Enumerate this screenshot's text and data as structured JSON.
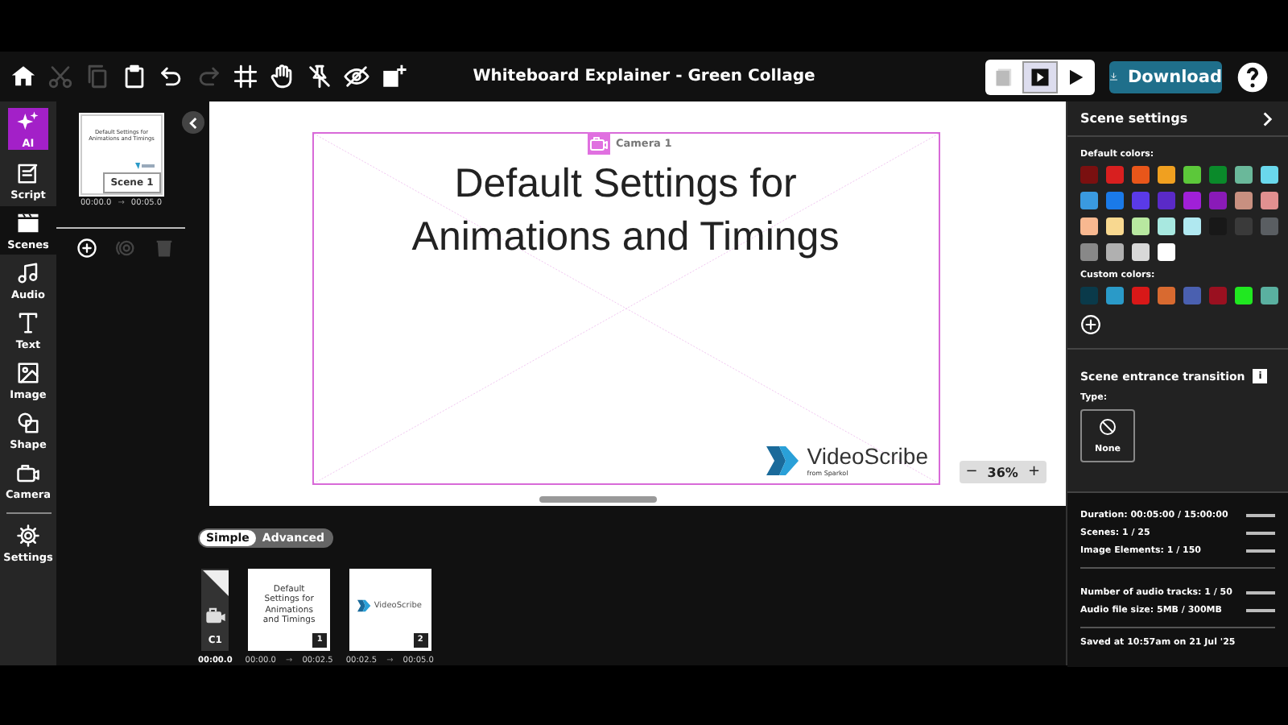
{
  "toolbar": {
    "items": [
      {
        "disabled": false
      },
      {
        "disabled": true
      },
      {
        "disabled": true
      },
      {
        "disabled": false
      },
      {
        "disabled": false
      },
      {
        "disabled": true
      },
      {
        "disabled": false
      },
      {
        "disabled": false
      },
      {
        "disabled": false
      },
      {
        "disabled": false
      },
      {
        "disabled": false
      }
    ],
    "title": "Whiteboard Explainer - Green Collage",
    "view_modes": [
      {
        "selected": false
      },
      {
        "selected": true
      },
      {
        "selected": false
      }
    ],
    "download": "Download"
  },
  "rail": {
    "items": [
      {
        "label": "AI",
        "selected": false,
        "kind": "ai"
      },
      {
        "label": "Script",
        "selected": false,
        "kind": "tool"
      },
      {
        "label": "Scenes",
        "selected": true,
        "kind": "tool"
      },
      {
        "label": "Audio",
        "selected": false,
        "kind": "tool"
      },
      {
        "label": "Text",
        "selected": false,
        "kind": "tool"
      },
      {
        "label": "Image",
        "selected": false,
        "kind": "tool"
      },
      {
        "label": "Shape",
        "selected": false,
        "kind": "tool"
      },
      {
        "label": "Camera",
        "selected": false,
        "kind": "tool"
      },
      {
        "label": "Settings",
        "selected": false,
        "kind": "tool"
      }
    ]
  },
  "scenes": {
    "items": [
      {
        "thumb_text": "Default Settings for Animations and Timings",
        "label": "Scene 1",
        "start": "00:00.0",
        "arrow": "→",
        "end": "00:05.0",
        "selected": true
      }
    ],
    "actions": [
      {
        "disabled": false
      },
      {
        "disabled": true
      },
      {
        "disabled": true
      }
    ]
  },
  "canvas": {
    "camera_label": "Camera 1",
    "heading": "Default Settings for Animations and Timings",
    "logo_name": "VideoScribe",
    "logo_tagline": "from Sparkol",
    "zoom": {
      "minus": "−",
      "value": "36%",
      "plus": "+"
    }
  },
  "mode_toggle": [
    {
      "label": "Simple",
      "selected": true
    },
    {
      "label": "Advanced",
      "selected": false
    }
  ],
  "timeline": {
    "camera": {
      "label": "C1",
      "time": "00:00.0"
    },
    "frames": [
      {
        "kind": "text",
        "text": "Default Settings for Animations and Timings",
        "number": "1",
        "start": "00:00.0",
        "arrow": "→",
        "end": "00:02.5"
      },
      {
        "kind": "logo",
        "text": "VideoScribe",
        "number": "2",
        "start": "00:02.5",
        "arrow": "→",
        "end": "00:05.0"
      }
    ]
  },
  "settings": {
    "title": "Scene settings",
    "default_colors_label": "Default colors:",
    "default_colors": [
      {
        "color": "#7a1010"
      },
      {
        "color": "#d81f1f"
      },
      {
        "color": "#e8561a"
      },
      {
        "color": "#f0a020"
      },
      {
        "color": "#5cc83a"
      },
      {
        "color": "#0a8a2a"
      },
      {
        "color": "#6ab89a"
      },
      {
        "color": "#6ad8ec"
      },
      {
        "color": "#3a9ae0"
      },
      {
        "color": "#1a7ae8"
      },
      {
        "color": "#5a3ae8"
      },
      {
        "color": "#5a2ac8"
      },
      {
        "color": "#a020d8"
      },
      {
        "color": "#8a1ab8"
      },
      {
        "color": "#c89080"
      },
      {
        "color": "#e09090"
      },
      {
        "color": "#f8b890"
      },
      {
        "color": "#f8d890"
      },
      {
        "color": "#b8e8a0"
      },
      {
        "color": "#a8e8e0"
      },
      {
        "color": "#b0e8f0"
      },
      {
        "color": "#181818"
      },
      {
        "color": "#3a3a3a"
      },
      {
        "color": "#5a5e62"
      },
      {
        "color": "#888888"
      },
      {
        "color": "#b0b0b0"
      },
      {
        "color": "#d8d8d8"
      },
      {
        "color": "#ffffff"
      }
    ],
    "custom_colors_label": "Custom colors:",
    "custom_colors": [
      {
        "color": "#0a3a4a"
      },
      {
        "color": "#2a9ac8"
      },
      {
        "color": "#d81818"
      },
      {
        "color": "#d86a30"
      },
      {
        "color": "#4a60b0"
      },
      {
        "color": "#9a1020"
      },
      {
        "color": "#20e820"
      },
      {
        "color": "#5ab0a0"
      }
    ],
    "transition_title": "Scene entrance transition",
    "info": "i",
    "type_label": "Type:",
    "type_value": "None"
  },
  "stats": {
    "groups": [
      [
        "Duration: 00:05:00 / 15:00:00",
        "Scenes: 1 / 25",
        "Image Elements: 1 / 150"
      ],
      [
        "Number of audio tracks: 1 / 50",
        "Audio file size: 5MB / 300MB"
      ]
    ],
    "saved": "Saved at 10:57am on 21 Jul '25"
  }
}
